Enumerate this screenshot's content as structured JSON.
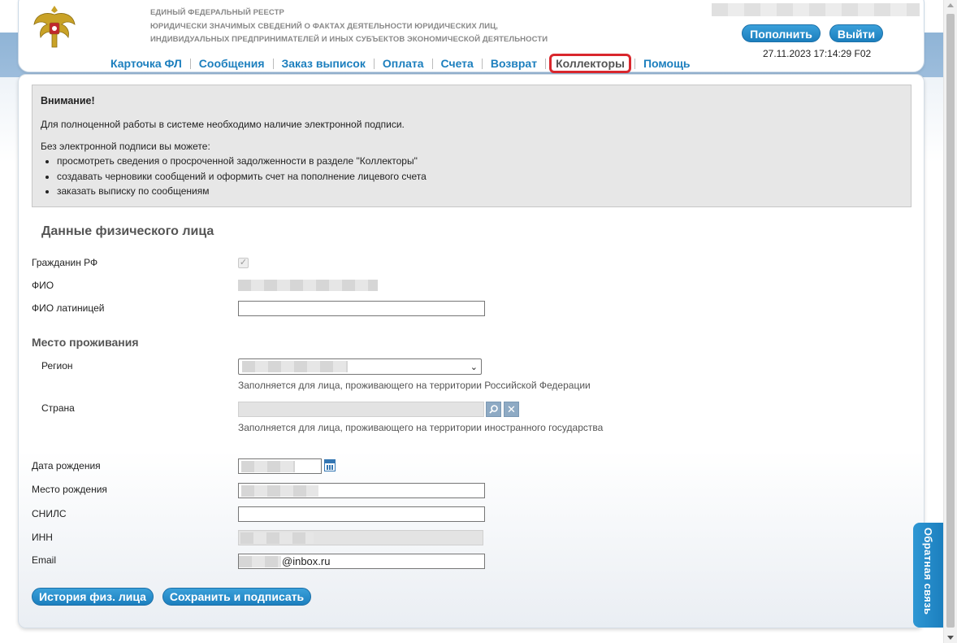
{
  "header": {
    "registry_line1": "ЕДИНЫЙ ФЕДЕРАЛЬНЫЙ РЕЕСТР",
    "registry_line2": "ЮРИДИЧЕСКИ ЗНАЧИМЫХ СВЕДЕНИЙ О ФАКТАХ ДЕЯТЕЛЬНОСТИ ЮРИДИЧЕСКИХ ЛИЦ,",
    "registry_line3": "ИНДИВИДУАЛЬНЫХ ПРЕДПРИНИМАТЕЛЕЙ И ИНЫХ СУБЪЕКТОВ ЭКОНОМИЧЕСКОЙ ДЕЯТЕЛЬНОСТИ",
    "topup_label": "Пополнить",
    "exit_label": "Выйти",
    "datetime": "27.11.2023 17:14:29 F02",
    "emblem_icon": "russian-coat-of-arms-icon"
  },
  "nav": {
    "items": [
      {
        "label": "Карточка ФЛ"
      },
      {
        "label": "Сообщения"
      },
      {
        "label": "Заказ выписок"
      },
      {
        "label": "Оплата"
      },
      {
        "label": "Счета"
      },
      {
        "label": "Возврат"
      },
      {
        "label": "Коллекторы"
      },
      {
        "label": "Помощь"
      }
    ],
    "active_index": 6,
    "highlight_color": "#d9272d"
  },
  "notice": {
    "title": "Внимание!",
    "paragraph": "Для полноценной работы в системе необходимо наличие электронной подписи.",
    "intro": "Без электронной подписи вы можете:",
    "items": [
      "просмотреть сведения о просроченной задолженности в разделе \"Коллекторы\"",
      "создавать черновики сообщений и оформить счет на пополнение лицевого счета",
      "заказать выписку по сообщениям"
    ]
  },
  "form": {
    "section_title": "Данные физического лица",
    "citizen_label": "Гражданин РФ",
    "citizen_checked": true,
    "fio_label": "ФИО",
    "fio_latin_label": "ФИО латиницей",
    "fio_latin_value": "",
    "residence_title": "Место проживания",
    "region_label": "Регион",
    "region_hint": "Заполняется для лица, проживающего на территории Российской Федерации",
    "country_label": "Страна",
    "country_hint": "Заполняется для лица, проживающего на территории иностранного государства",
    "birth_date_label": "Дата рождения",
    "birth_place_label": "Место рождения",
    "snils_label": "СНИЛС",
    "snils_value": "",
    "inn_label": "ИНН",
    "email_label": "Email",
    "email_visible_suffix": "@inbox.ru"
  },
  "buttons": {
    "history_label": "История физ. лица",
    "save_sign_label": "Сохранить и подписать"
  },
  "feedback": {
    "label": "Обратная связь"
  },
  "colors": {
    "accent_blue": "#1c7fbe",
    "header_band": "#8fb4d6"
  }
}
